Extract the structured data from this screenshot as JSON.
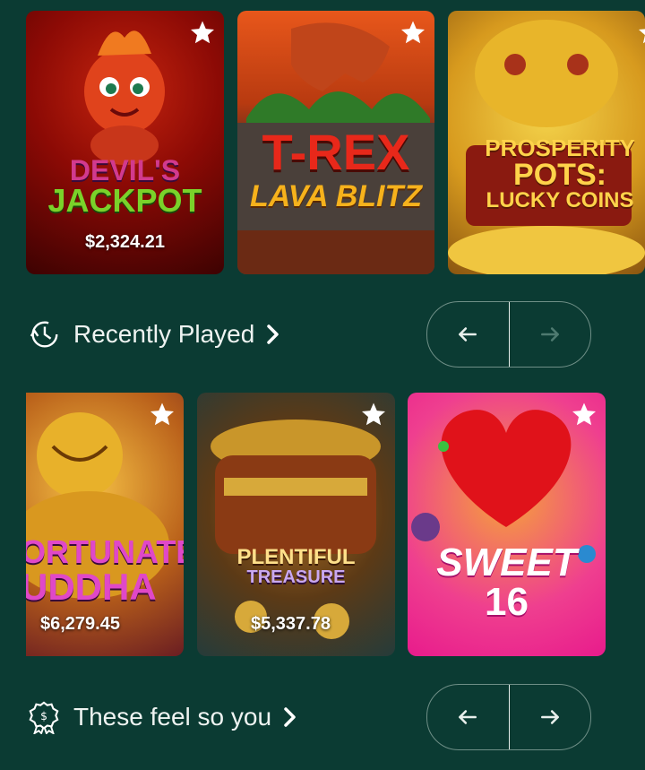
{
  "colors": {
    "background": "#0b3b33",
    "pager_border": "#6f8f87",
    "arrow_active": "#e8efec",
    "arrow_disabled": "#4e7a70"
  },
  "row1": {
    "cards": [
      {
        "title_line1": "DEVIL'S",
        "title_line2": "JACKPOT",
        "jackpot": "$2,324.21",
        "favorite_icon": "star-icon"
      },
      {
        "title_line1": "T-REX",
        "title_line2": "LAVA BLITZ",
        "favorite_icon": "star-icon"
      },
      {
        "title_line1": "PROSPERITY",
        "title_line2": "POTS:",
        "title_line3": "LUCKY COINS",
        "favorite_icon": "star-icon"
      }
    ]
  },
  "recently_played": {
    "title": "Recently Played",
    "icon": "history-clock-icon",
    "pager": {
      "prev_enabled": true,
      "next_enabled": false
    }
  },
  "row2": {
    "cards": [
      {
        "title_line1": "ORTUNATE",
        "title_line2": "UDDHA",
        "jackpot": "$6,279.45",
        "favorite_icon": "star-icon"
      },
      {
        "title_line1": "PLENTIFUL",
        "title_line2": "TREASURE",
        "jackpot": "$5,337.78",
        "favorite_icon": "star-icon"
      },
      {
        "title_line1": "SWEET",
        "title_line2": "16",
        "favorite_icon": "star-icon"
      }
    ]
  },
  "these_feel_so_you": {
    "title": "These feel so you",
    "icon": "dollar-award-icon",
    "pager": {
      "prev_enabled": true,
      "next_enabled": true
    }
  }
}
